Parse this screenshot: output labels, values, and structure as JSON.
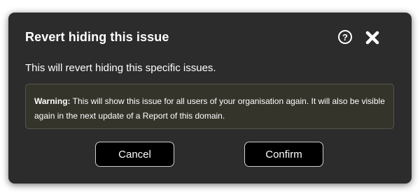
{
  "dialog": {
    "title": "Revert hiding this issue",
    "subtitle": "This will revert hiding this specific issues.",
    "help_glyph": "?",
    "help_icon": "question-circle-icon",
    "close_icon": "close-x-icon",
    "warning": {
      "label": "Warning:",
      "text": " This will show this issue for all users of your organisation again. It will also be visible again in the next update of a Report of this domain."
    },
    "buttons": {
      "cancel": "Cancel",
      "confirm": "Confirm"
    }
  },
  "colors": {
    "dialog_background": "#2c2c2c",
    "warning_background": "#34342b",
    "button_background": "#000000",
    "text": "#ffffff"
  }
}
